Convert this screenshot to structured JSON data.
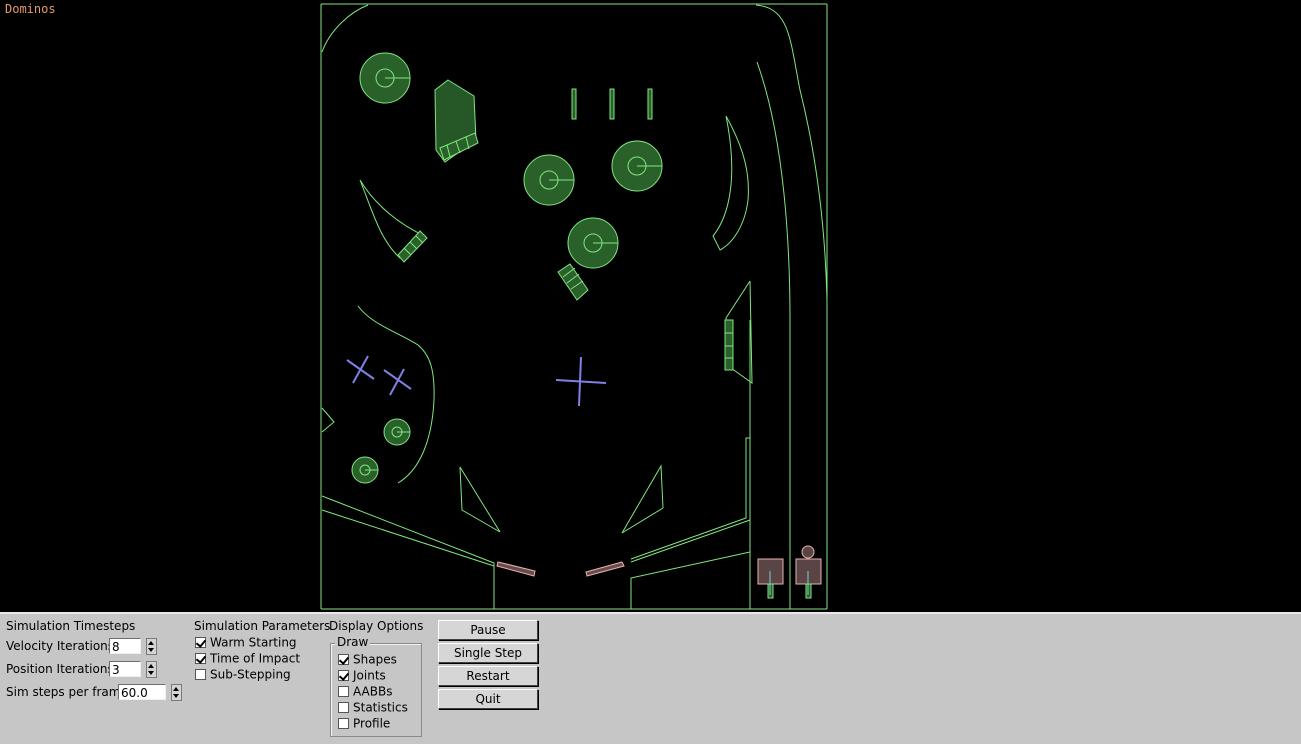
{
  "demo_title": "Dominos",
  "colors": {
    "shape_outline": "#80e680",
    "shape_fill": "#2a602a",
    "static_outline": "#80e680",
    "kinematic_outline": "#8080e6",
    "dynamic_red_outline": "#e6b3b3",
    "joint_color": "#80cccc",
    "title_color": "#e69966",
    "panel_bg": "#c6c6c6"
  },
  "panel": {
    "timesteps": {
      "title": "Simulation Timesteps",
      "velocity_label": "Velocity Iterations",
      "velocity_value": "8",
      "position_label": "Position Iterations",
      "position_value": "3",
      "hz_label": "Sim steps per frame",
      "hz_value": "60.0"
    },
    "parameters": {
      "title": "Simulation Parameters",
      "warm_starting": "Warm Starting",
      "warm_starting_checked": true,
      "time_of_impact": "Time of Impact",
      "time_of_impact_checked": true,
      "sub_stepping": "Sub-Stepping",
      "sub_stepping_checked": false
    },
    "display": {
      "title": "Display Options",
      "group_title": "Draw",
      "shapes": "Shapes",
      "shapes_checked": true,
      "joints": "Joints",
      "joints_checked": true,
      "aabbs": "AABBs",
      "aabbs_checked": false,
      "statistics": "Statistics",
      "statistics_checked": false,
      "profile": "Profile",
      "profile_checked": false
    },
    "buttons": {
      "pause": "Pause",
      "single_step": "Single Step",
      "restart": "Restart",
      "quit": "Quit"
    }
  }
}
